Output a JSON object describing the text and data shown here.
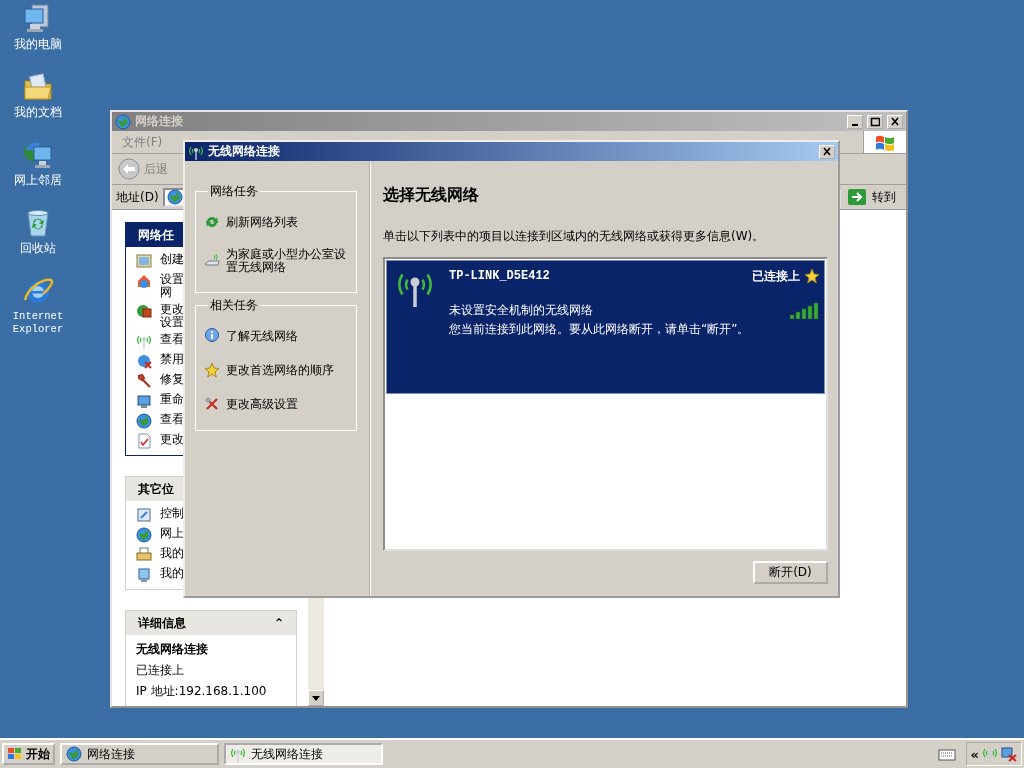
{
  "desktop_icons": [
    {
      "label": "我的电脑",
      "kind": "computer"
    },
    {
      "label": "我的文档",
      "kind": "documents"
    },
    {
      "label": "网上邻居",
      "kind": "network"
    },
    {
      "label": "回收站",
      "kind": "recycle"
    },
    {
      "label": "Internet Explorer",
      "kind": "browser"
    }
  ],
  "background_window": {
    "title": "网络连接",
    "menu": [
      "文件(F)"
    ],
    "back_button": "后退",
    "address_label": "地址(D)",
    "go_button": "转到",
    "task_panel": {
      "title": "网络任",
      "items": [
        "创建",
        "设置网",
        "更改设置",
        "查看",
        "禁用",
        "修复",
        "重命",
        "查看",
        "更改"
      ]
    },
    "other_places": {
      "title": "其它位",
      "items": [
        "控制",
        "网上",
        "我的",
        "我的"
      ]
    },
    "details": {
      "title": "详细信息",
      "expand": "⌃",
      "name": "无线网络连接",
      "status": "已连接上",
      "ip": "IP 地址:192.168.1.100"
    }
  },
  "dialog": {
    "title": "无线网络连接",
    "groups": [
      {
        "title": "网络任务",
        "items": [
          "刷新网络列表",
          "为家庭或小型办公室设置无线网络"
        ]
      },
      {
        "title": "相关任务",
        "items": [
          "了解无线网络",
          "更改首选网络的顺序",
          "更改高级设置"
        ]
      }
    ],
    "heading": "选择无线网络",
    "description": "单击以下列表中的项目以连接到区域内的无线网络或获得更多信息(W)。",
    "networks": [
      {
        "name": "TP-LINK_D5E412",
        "status": "已连接上",
        "preferred": true,
        "selected": true,
        "security": "未设置安全机制的无线网络",
        "message": "您当前连接到此网络。要从此网络断开，请单击“断开”。"
      }
    ],
    "button": "断开(D)"
  },
  "taskbar": {
    "start": "开始",
    "tasks": [
      {
        "label": "网络连接",
        "kind": "network",
        "selected": false
      },
      {
        "label": "无线网络连接",
        "kind": "wireless",
        "selected": true
      }
    ],
    "tray_expand": "«"
  }
}
